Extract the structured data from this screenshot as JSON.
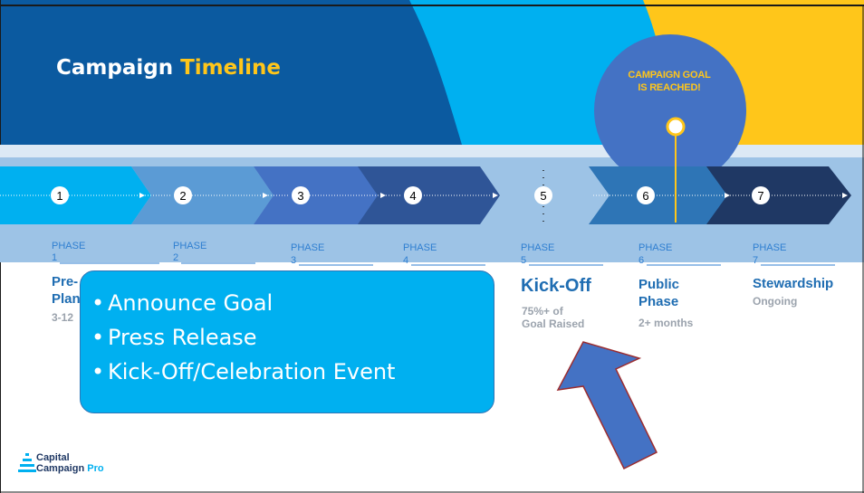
{
  "title": {
    "main": "Campaign",
    "highlight": "Timeline"
  },
  "goal": {
    "line1": "CAMPAIGN GOAL",
    "line2": "IS REACHED!"
  },
  "phases": [
    {
      "word": "PHASE",
      "number": "1",
      "name_lines": [
        "Pre-",
        "Plan"
      ],
      "sub_lines": [
        "3-12"
      ]
    },
    {
      "word": "PHASE",
      "number": "2",
      "name_lines": [],
      "sub_lines": []
    },
    {
      "word": "PHASE",
      "number": "3",
      "name_lines": [],
      "sub_lines": []
    },
    {
      "word": "PHASE",
      "number": "4",
      "name_lines": [],
      "sub_lines": []
    },
    {
      "word": "PHASE",
      "number": "5",
      "name_lines": [
        "Kick-Off"
      ],
      "sub_lines": [
        "75%+ of",
        "Goal Raised"
      ]
    },
    {
      "word": "PHASE",
      "number": "6",
      "name_lines": [
        "Public",
        "Phase"
      ],
      "sub_lines": [
        "2+ months"
      ]
    },
    {
      "word": "PHASE",
      "number": "7",
      "name_lines": [
        "Stewardship"
      ],
      "sub_lines": [
        "Ongoing"
      ]
    }
  ],
  "callout": {
    "items": [
      "Announce Goal",
      "Press Release",
      "Kick-Off/Celebration Event"
    ]
  },
  "logo": {
    "line1": "Capital",
    "line2": "Campaign",
    "line2_accent": "Pro"
  },
  "colors": {
    "dark_blue": "#0b5aa0",
    "light_blue": "#00b0f0",
    "yellow": "#ffc61a",
    "band": "#9dc3e6",
    "circle": "#4472c4",
    "arrow_blue": "#4472c4"
  }
}
